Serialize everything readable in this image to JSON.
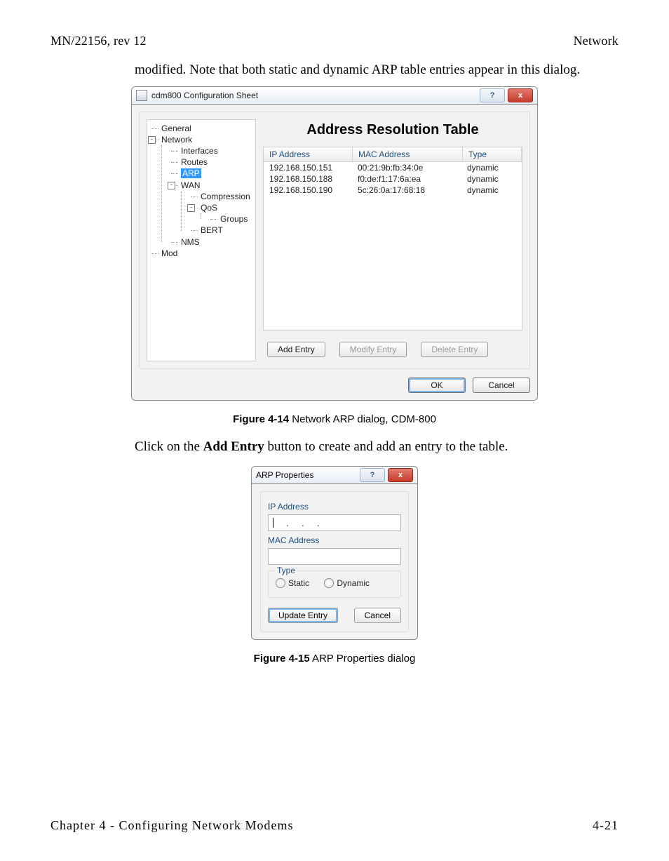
{
  "header": {
    "left": "MN/22156, rev 12",
    "right": "Network"
  },
  "footer": {
    "left": "Chapter 4 - Configuring Network Modems",
    "right": "4-21"
  },
  "para1": "modified. Note that both static and dynamic ARP table entries appear in this dialog.",
  "fig14": {
    "label": "Figure 4-14",
    "text": "  Network ARP dialog, CDM-800"
  },
  "para2a": "Click on the ",
  "para2b": "Add Entry",
  "para2c": " button to create and add an entry to the table.",
  "fig15": {
    "label": "Figure 4-15",
    "text": "  ARP Properties dialog"
  },
  "dlg1": {
    "title": "cdm800 Configuration Sheet",
    "help": "?",
    "close": "x",
    "pane_title": "Address Resolution Table",
    "tree": {
      "general": "General",
      "network": "Network",
      "interfaces": "Interfaces",
      "routes": "Routes",
      "arp": "ARP",
      "wan": "WAN",
      "compression": "Compression",
      "qos": "QoS",
      "groups": "Groups",
      "bert": "BERT",
      "nms": "NMS",
      "mod": "Mod"
    },
    "cols": {
      "ip": "IP Address",
      "mac": "MAC Address",
      "type": "Type"
    },
    "rows": [
      {
        "ip": "192.168.150.151",
        "mac": "00:21:9b:fb:34:0e",
        "type": "dynamic"
      },
      {
        "ip": "192.168.150.188",
        "mac": "f0:de:f1:17:6a:ea",
        "type": "dynamic"
      },
      {
        "ip": "192.168.150.190",
        "mac": "5c:26:0a:17:68:18",
        "type": "dynamic"
      }
    ],
    "btn": {
      "add": "Add Entry",
      "modify": "Modify Entry",
      "delete": "Delete Entry",
      "ok": "OK",
      "cancel": "Cancel"
    }
  },
  "dlg2": {
    "title": "ARP Properties",
    "help": "?",
    "close": "x",
    "ip_label": "IP Address",
    "mac_label": "MAC Address",
    "type_label": "Type",
    "static": "Static",
    "dynamic": "Dynamic",
    "update": "Update Entry",
    "cancel": "Cancel",
    "dot": "."
  }
}
